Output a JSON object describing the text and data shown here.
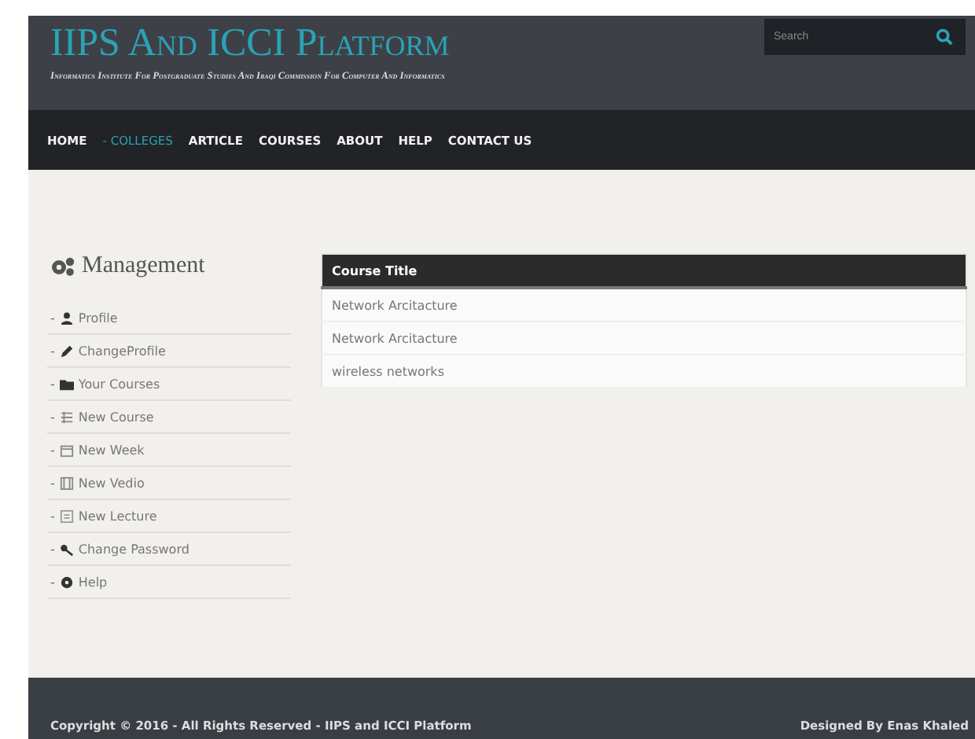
{
  "header": {
    "title": "IIPS And ICCI Platform",
    "subtitle": "Informatics Institute For Postgraduate Studies And Iraqi Commission For Computer And Informatics",
    "search": {
      "placeholder": "Search"
    }
  },
  "nav": [
    {
      "label": "HOME",
      "selected": false
    },
    {
      "label": "- COLLEGES",
      "selected": true
    },
    {
      "label": "ARTICLE",
      "selected": false
    },
    {
      "label": "COURSES",
      "selected": false
    },
    {
      "label": "ABOUT",
      "selected": false
    },
    {
      "label": "HELP",
      "selected": false
    },
    {
      "label": "CONTACT US",
      "selected": false
    }
  ],
  "sidebar": {
    "title": "Management",
    "items": [
      {
        "bullet": "-",
        "label": "Profile"
      },
      {
        "bullet": "-",
        "label": "ChangeProfile"
      },
      {
        "bullet": "-",
        "label": "Your Courses"
      },
      {
        "bullet": "-",
        "label": "New Course"
      },
      {
        "bullet": "-",
        "label": "New Week"
      },
      {
        "bullet": "-",
        "label": "New Vedio"
      },
      {
        "bullet": "-",
        "label": "New Lecture"
      },
      {
        "bullet": "-",
        "label": "Change Password"
      },
      {
        "bullet": "-",
        "label": "Help"
      }
    ]
  },
  "table": {
    "columns": [
      "Course Title"
    ],
    "rows": [
      [
        "Network Arcitacture"
      ],
      [
        "Network Arcitacture"
      ],
      [
        "wireless networks"
      ]
    ]
  },
  "footer": {
    "copyright": "Copyright © 2016 - All Rights Reserved - IIPS and ICCI Platform",
    "credit": "Designed By Enas Khaled"
  }
}
